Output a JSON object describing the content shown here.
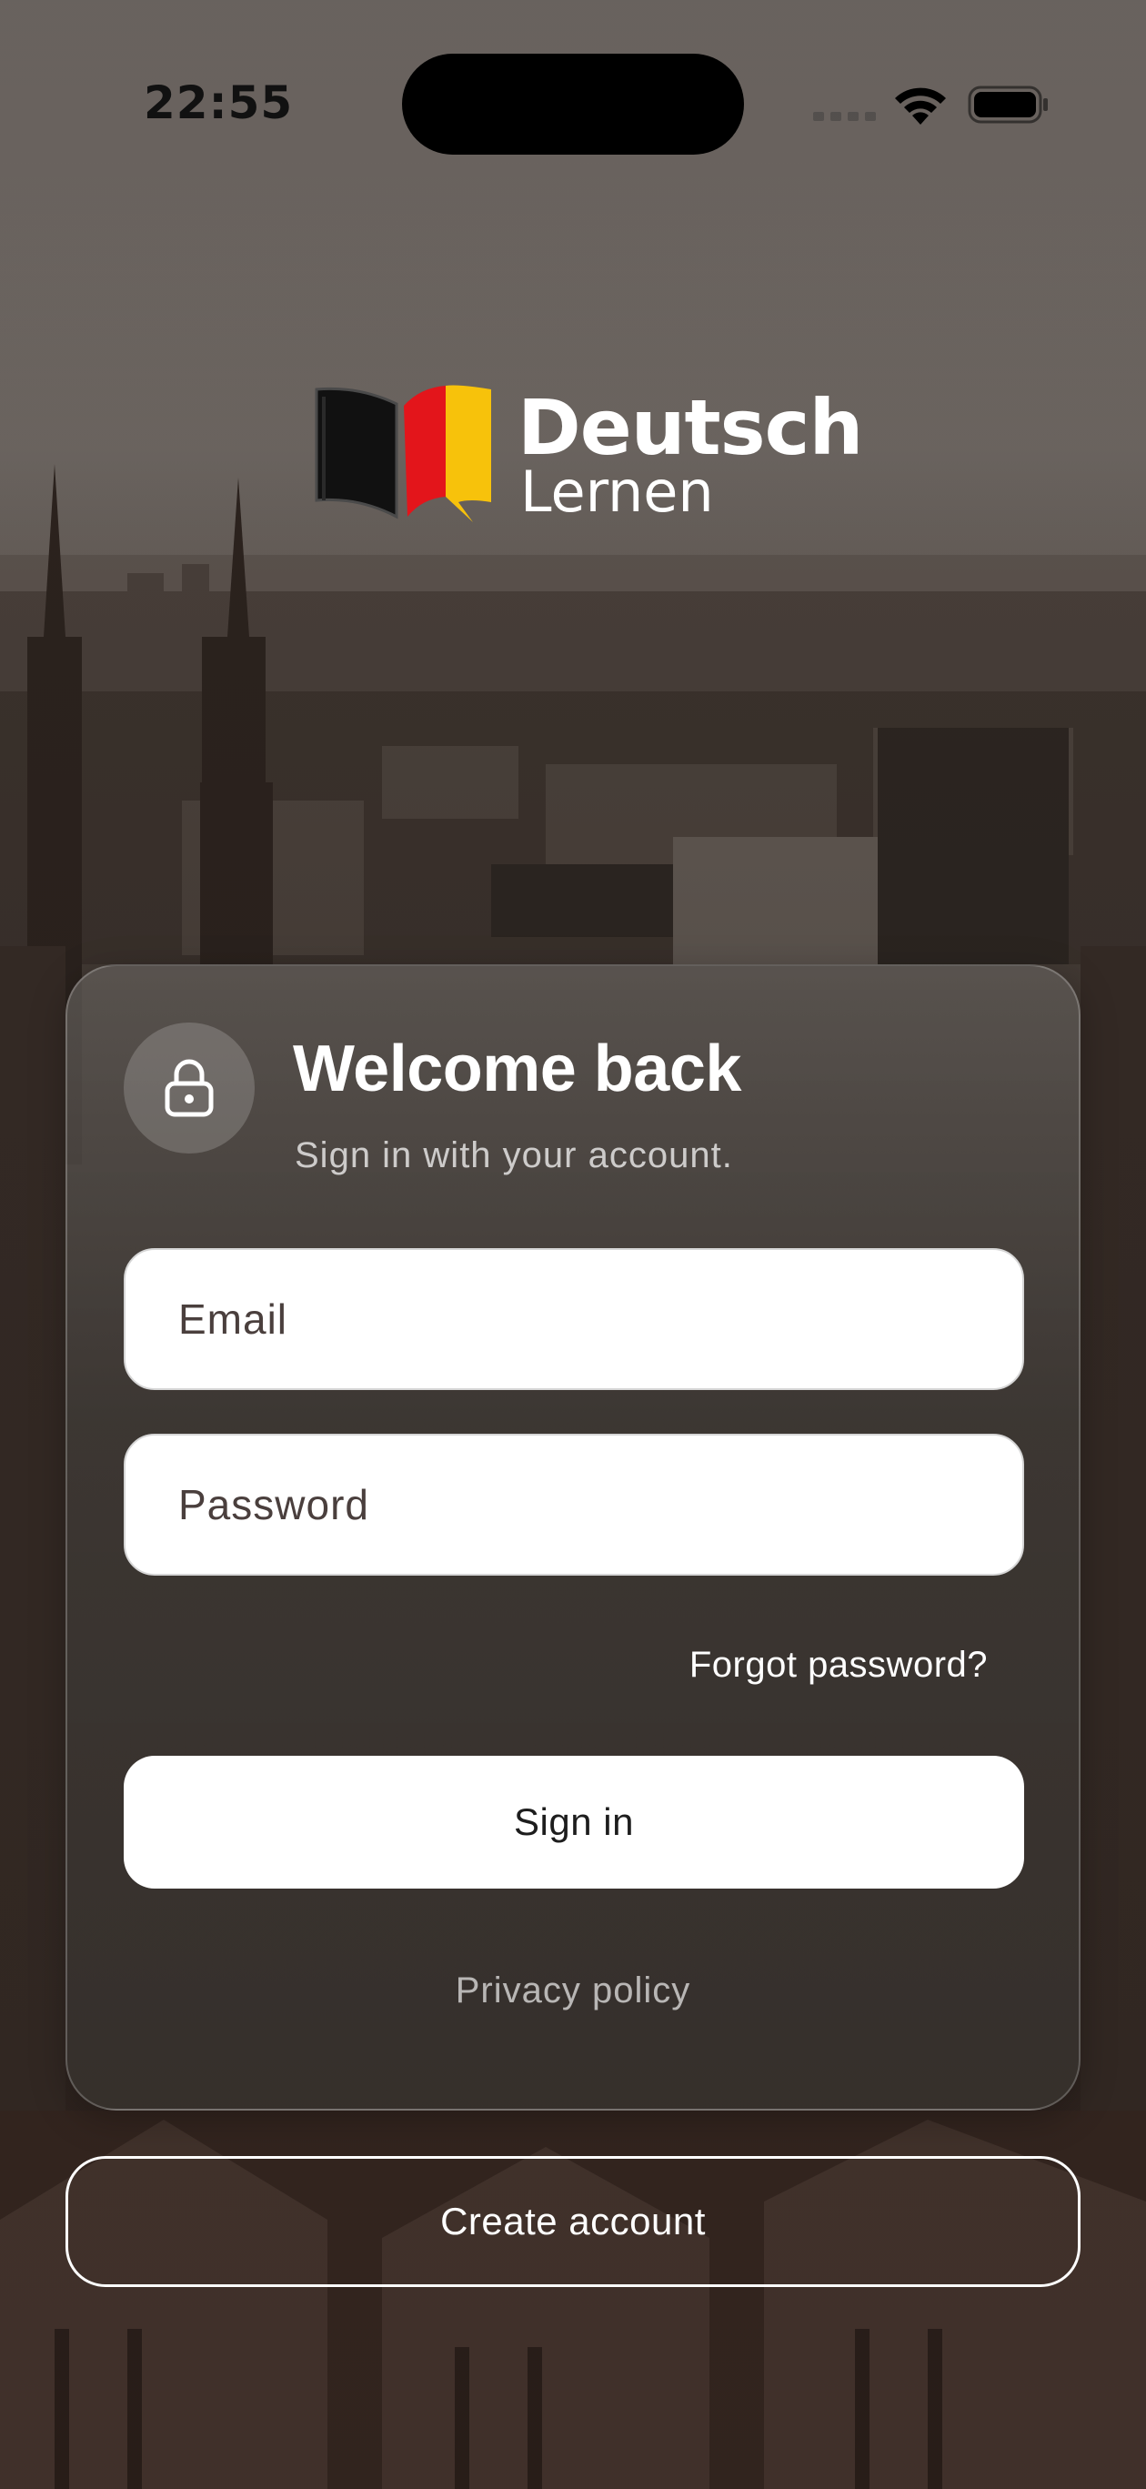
{
  "status_bar": {
    "time": "22:55"
  },
  "logo": {
    "word1": "Deutsch",
    "word2": "Lernen",
    "flag_colors": [
      "#111111",
      "#e3151b",
      "#f7c20b"
    ]
  },
  "card": {
    "title": "Welcome back",
    "subtitle": "Sign in with your account.",
    "icon": "lock-icon",
    "email_placeholder": "Email",
    "password_placeholder": "Password",
    "forgot_label": "Forgot password?",
    "signin_label": "Sign in",
    "privacy_label": "Privacy policy"
  },
  "footer": {
    "create_account_label": "Create account"
  },
  "colors": {
    "button_bg": "#ffffff",
    "card_bg": "#3e3935",
    "text_primary": "#ffffff"
  }
}
